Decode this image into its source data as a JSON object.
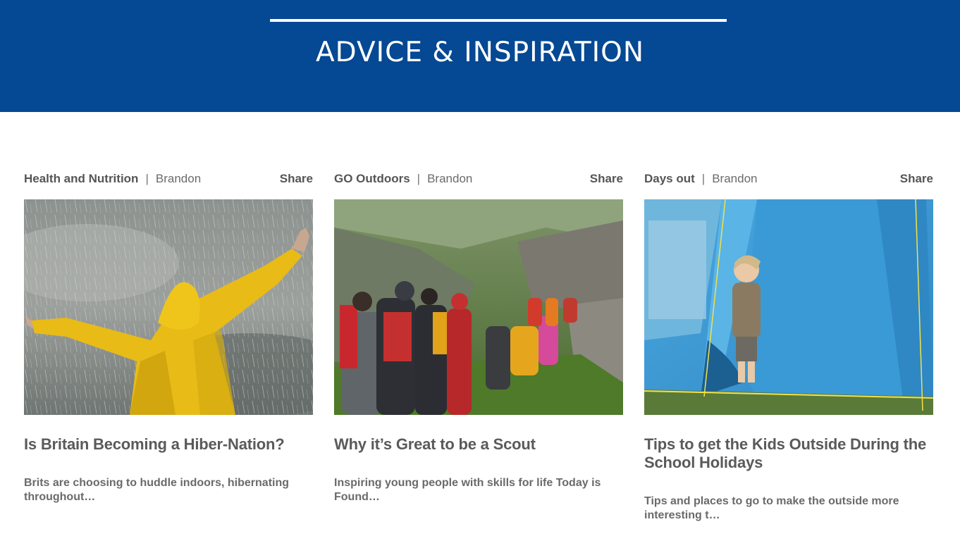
{
  "banner": {
    "title": "ADVICE & INSPIRATION"
  },
  "cards": [
    {
      "category": "Health and Nutrition",
      "separator": "|",
      "author": "Brandon",
      "share": "Share",
      "headline": "Is Britain Becoming a Hiber-Nation?",
      "excerpt": "Brits are choosing to huddle indoors, hibernating throughout…"
    },
    {
      "category": "GO Outdoors",
      "separator": "|",
      "author": "Brandon",
      "share": "Share",
      "headline": "Why it’s Great to be a Scout",
      "excerpt": "Inspiring young people with skills for life Today is Found…"
    },
    {
      "category": "Days out",
      "separator": "|",
      "author": "Brandon",
      "share": "Share",
      "headline": "Tips to get the Kids Outside During the School Holidays",
      "excerpt": "Tips and places to go to make the outside more interesting t…"
    }
  ]
}
